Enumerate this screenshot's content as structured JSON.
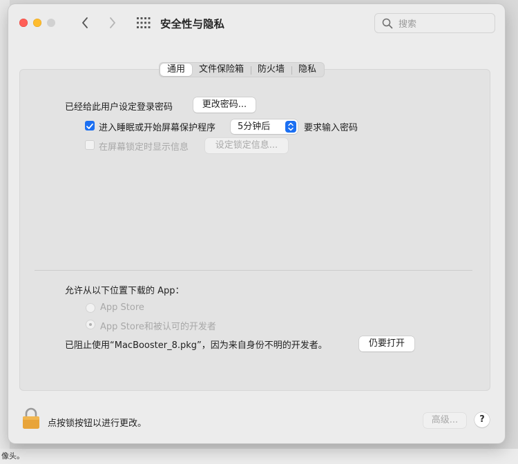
{
  "window": {
    "title": "安全性与隐私",
    "search_placeholder": "搜索"
  },
  "background": {
    "bottom_text": "像头。"
  },
  "tabs": [
    {
      "label": "通用",
      "active": true
    },
    {
      "label": "文件保险箱",
      "active": false
    },
    {
      "label": "防火墙",
      "active": false
    },
    {
      "label": "隐私",
      "active": false
    }
  ],
  "general": {
    "password_set_label": "已经给此用户设定登录密码",
    "change_password_button": "更改密码...",
    "sleep_checkbox_label": "进入睡眠或开始屏幕保护程序",
    "sleep_checkbox_checked": true,
    "sleep_delay_value": "5分钟后",
    "require_password_label": "要求输入密码",
    "show_message_label": "在屏幕锁定时显示信息",
    "show_message_checked": false,
    "set_lock_message_button": "设定锁定信息..."
  },
  "downloads": {
    "heading": "允许从以下位置下载的 App：",
    "options": [
      {
        "label": "App Store",
        "selected": false
      },
      {
        "label": "App Store和被认可的开发者",
        "selected": true
      }
    ],
    "blocked_message": "已阻止使用“MacBooster_8.pkg”，因为来自身份不明的开发者。",
    "open_anyway_button": "仍要打开"
  },
  "footer": {
    "lock_label": "点按锁按钮以进行更改。",
    "advanced_button": "高级...",
    "help_button": "?"
  },
  "colors": {
    "accent": "#1b6ff2",
    "close": "#ff5f57",
    "minimize": "#febc2e",
    "lock_body": "#e8a43a"
  }
}
